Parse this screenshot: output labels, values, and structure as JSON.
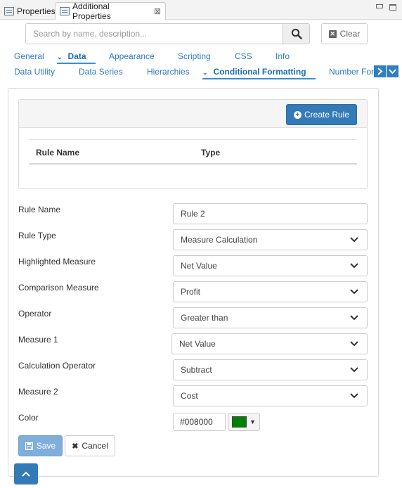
{
  "view_tabs": [
    {
      "label": "Properties",
      "icon": "properties-view-icon"
    },
    {
      "label": "Additional Properties",
      "icon": "additional-properties-view-icon",
      "close": "⊠"
    }
  ],
  "search": {
    "placeholder": "Search by name, description...",
    "value": "",
    "button_icon": "search-icon"
  },
  "clear_button": {
    "label": "Clear",
    "icon": "clear-icon"
  },
  "nav": {
    "row1": [
      "General",
      "Data",
      "Appearance",
      "Scripting",
      "CSS",
      "Info"
    ],
    "row2": [
      "Data Utility",
      "Data Series",
      "Hierarchies",
      "Conditional Formatting",
      "Number For"
    ],
    "active_row1": "Data",
    "active_row2": "Conditional Formatting"
  },
  "rules": {
    "create_button": "Create Rule",
    "columns": [
      "Rule Name",
      "Type"
    ],
    "rows": []
  },
  "form": {
    "rule_name": {
      "label": "Rule Name",
      "value": "Rule 2"
    },
    "rule_type": {
      "label": "Rule Type",
      "value": "Measure Calculation"
    },
    "highlighted_measure": {
      "label": "Highlighted Measure",
      "value": "Net Value"
    },
    "comparison_measure": {
      "label": "Comparison Measure",
      "value": "Profit"
    },
    "operator": {
      "label": "Operator",
      "value": "Greater than"
    },
    "measure1": {
      "label": "Measure 1",
      "value": "Net Value"
    },
    "calculation_operator": {
      "label": "Calculation Operator",
      "value": "Subtract"
    },
    "measure2": {
      "label": "Measure 2",
      "value": "Cost"
    },
    "color": {
      "label": "Color",
      "value": "#008000",
      "swatch": "#008000"
    }
  },
  "actions": {
    "save": "Save",
    "cancel": "Cancel"
  },
  "colors": {
    "accent": "#337ab7",
    "tab_text": "#2c7bbf",
    "save_disabled": "#7faedb"
  }
}
